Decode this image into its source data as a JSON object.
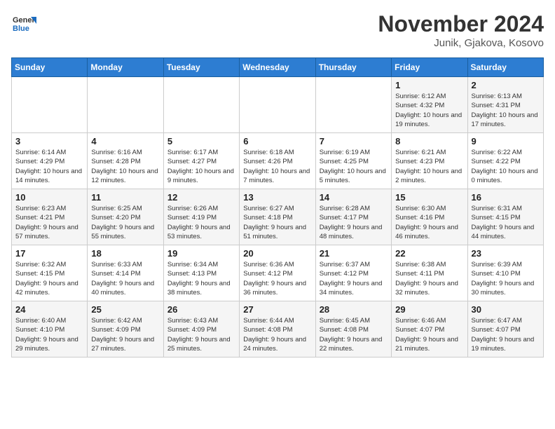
{
  "logo": {
    "general": "General",
    "blue": "Blue"
  },
  "title": "November 2024",
  "location": "Junik, Gjakova, Kosovo",
  "days_of_week": [
    "Sunday",
    "Monday",
    "Tuesday",
    "Wednesday",
    "Thursday",
    "Friday",
    "Saturday"
  ],
  "weeks": [
    [
      {
        "day": "",
        "info": ""
      },
      {
        "day": "",
        "info": ""
      },
      {
        "day": "",
        "info": ""
      },
      {
        "day": "",
        "info": ""
      },
      {
        "day": "",
        "info": ""
      },
      {
        "day": "1",
        "info": "Sunrise: 6:12 AM\nSunset: 4:32 PM\nDaylight: 10 hours and 19 minutes."
      },
      {
        "day": "2",
        "info": "Sunrise: 6:13 AM\nSunset: 4:31 PM\nDaylight: 10 hours and 17 minutes."
      }
    ],
    [
      {
        "day": "3",
        "info": "Sunrise: 6:14 AM\nSunset: 4:29 PM\nDaylight: 10 hours and 14 minutes."
      },
      {
        "day": "4",
        "info": "Sunrise: 6:16 AM\nSunset: 4:28 PM\nDaylight: 10 hours and 12 minutes."
      },
      {
        "day": "5",
        "info": "Sunrise: 6:17 AM\nSunset: 4:27 PM\nDaylight: 10 hours and 9 minutes."
      },
      {
        "day": "6",
        "info": "Sunrise: 6:18 AM\nSunset: 4:26 PM\nDaylight: 10 hours and 7 minutes."
      },
      {
        "day": "7",
        "info": "Sunrise: 6:19 AM\nSunset: 4:25 PM\nDaylight: 10 hours and 5 minutes."
      },
      {
        "day": "8",
        "info": "Sunrise: 6:21 AM\nSunset: 4:23 PM\nDaylight: 10 hours and 2 minutes."
      },
      {
        "day": "9",
        "info": "Sunrise: 6:22 AM\nSunset: 4:22 PM\nDaylight: 10 hours and 0 minutes."
      }
    ],
    [
      {
        "day": "10",
        "info": "Sunrise: 6:23 AM\nSunset: 4:21 PM\nDaylight: 9 hours and 57 minutes."
      },
      {
        "day": "11",
        "info": "Sunrise: 6:25 AM\nSunset: 4:20 PM\nDaylight: 9 hours and 55 minutes."
      },
      {
        "day": "12",
        "info": "Sunrise: 6:26 AM\nSunset: 4:19 PM\nDaylight: 9 hours and 53 minutes."
      },
      {
        "day": "13",
        "info": "Sunrise: 6:27 AM\nSunset: 4:18 PM\nDaylight: 9 hours and 51 minutes."
      },
      {
        "day": "14",
        "info": "Sunrise: 6:28 AM\nSunset: 4:17 PM\nDaylight: 9 hours and 48 minutes."
      },
      {
        "day": "15",
        "info": "Sunrise: 6:30 AM\nSunset: 4:16 PM\nDaylight: 9 hours and 46 minutes."
      },
      {
        "day": "16",
        "info": "Sunrise: 6:31 AM\nSunset: 4:15 PM\nDaylight: 9 hours and 44 minutes."
      }
    ],
    [
      {
        "day": "17",
        "info": "Sunrise: 6:32 AM\nSunset: 4:15 PM\nDaylight: 9 hours and 42 minutes."
      },
      {
        "day": "18",
        "info": "Sunrise: 6:33 AM\nSunset: 4:14 PM\nDaylight: 9 hours and 40 minutes."
      },
      {
        "day": "19",
        "info": "Sunrise: 6:34 AM\nSunset: 4:13 PM\nDaylight: 9 hours and 38 minutes."
      },
      {
        "day": "20",
        "info": "Sunrise: 6:36 AM\nSunset: 4:12 PM\nDaylight: 9 hours and 36 minutes."
      },
      {
        "day": "21",
        "info": "Sunrise: 6:37 AM\nSunset: 4:12 PM\nDaylight: 9 hours and 34 minutes."
      },
      {
        "day": "22",
        "info": "Sunrise: 6:38 AM\nSunset: 4:11 PM\nDaylight: 9 hours and 32 minutes."
      },
      {
        "day": "23",
        "info": "Sunrise: 6:39 AM\nSunset: 4:10 PM\nDaylight: 9 hours and 30 minutes."
      }
    ],
    [
      {
        "day": "24",
        "info": "Sunrise: 6:40 AM\nSunset: 4:10 PM\nDaylight: 9 hours and 29 minutes."
      },
      {
        "day": "25",
        "info": "Sunrise: 6:42 AM\nSunset: 4:09 PM\nDaylight: 9 hours and 27 minutes."
      },
      {
        "day": "26",
        "info": "Sunrise: 6:43 AM\nSunset: 4:09 PM\nDaylight: 9 hours and 25 minutes."
      },
      {
        "day": "27",
        "info": "Sunrise: 6:44 AM\nSunset: 4:08 PM\nDaylight: 9 hours and 24 minutes."
      },
      {
        "day": "28",
        "info": "Sunrise: 6:45 AM\nSunset: 4:08 PM\nDaylight: 9 hours and 22 minutes."
      },
      {
        "day": "29",
        "info": "Sunrise: 6:46 AM\nSunset: 4:07 PM\nDaylight: 9 hours and 21 minutes."
      },
      {
        "day": "30",
        "info": "Sunrise: 6:47 AM\nSunset: 4:07 PM\nDaylight: 9 hours and 19 minutes."
      }
    ]
  ]
}
